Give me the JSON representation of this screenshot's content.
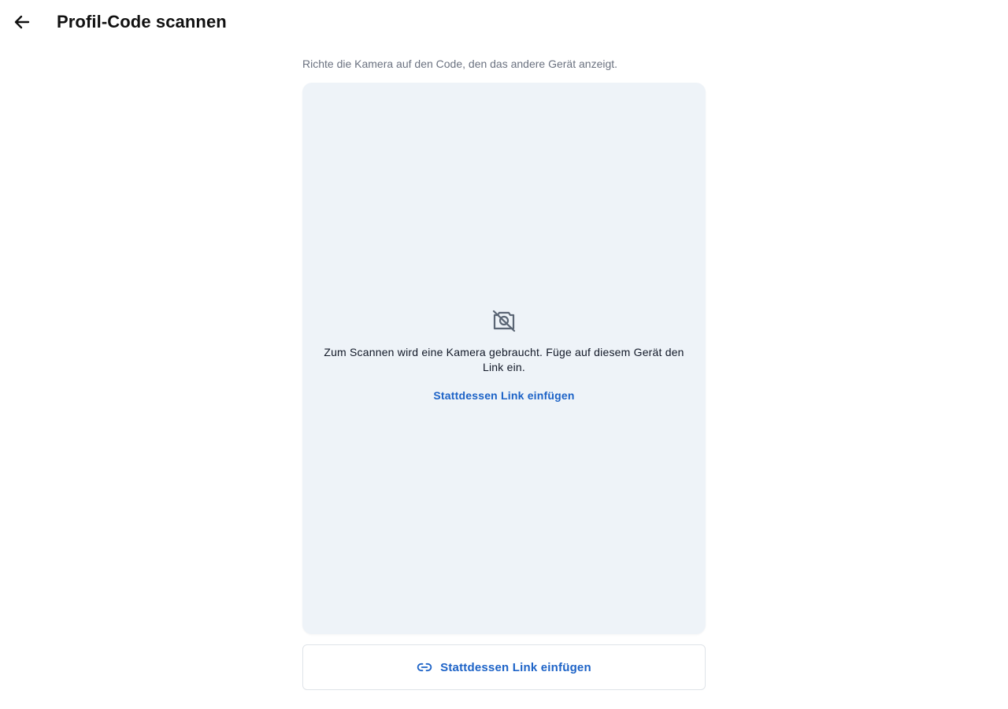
{
  "header": {
    "back_icon": "arrow-left-icon",
    "title": "Profil-Code scannen"
  },
  "main": {
    "instruction": "Richte die Kamera auf den Code, den das andere Gerät anzeigt.",
    "scanner": {
      "icon": "camera-off-icon",
      "message": "Zum Scannen wird eine Kamera gebraucht. Füge auf diesem Gerät den Link ein.",
      "link_label": "Stattdessen Link einfügen"
    },
    "paste_button": {
      "icon": "link-icon",
      "label": "Stattdessen Link einfügen"
    }
  },
  "colors": {
    "accent": "#1d63c7",
    "scanner_bg": "#eef3f8",
    "muted_text": "#6b7280"
  }
}
